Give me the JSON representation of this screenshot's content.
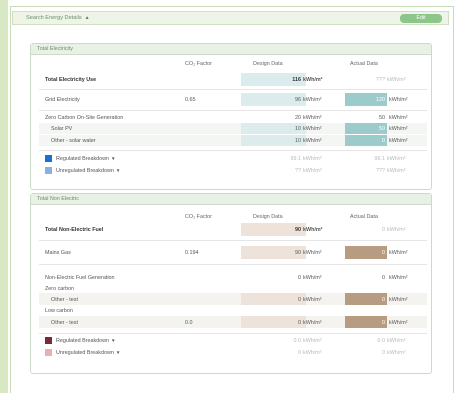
{
  "header": {
    "title": "Search Energy Details",
    "edit_label": "Edit"
  },
  "electricity": {
    "panel_title": "Total Electricity",
    "col_co2": "CO₂ Factor",
    "col_design": "Design Data",
    "col_actual": "Actual Data",
    "rows": {
      "total": {
        "label": "Total Electricity Use",
        "design": "116",
        "design_unit": "kWh/m²",
        "actual": "???",
        "actual_unit": "kWh/m²"
      },
      "grid": {
        "label": "Grid Electricity",
        "co2": "0.65",
        "design": "96",
        "design_unit": "kWh/m²",
        "actual": "120",
        "actual_unit": "kWh/m²"
      },
      "zero_carbon": {
        "label": "Zero Carbon On-Site Generation",
        "design": "20",
        "design_unit": "kWh/m²",
        "actual": "50",
        "actual_unit": "kWh/m²"
      },
      "solar_pv": {
        "label": "Solar PV",
        "design": "10",
        "design_unit": "kWh/m²",
        "actual": "50",
        "actual_unit": "kWh/m²"
      },
      "other_solar": {
        "label": "Other - solar water",
        "design": "10",
        "design_unit": "kWh/m²",
        "actual": "0",
        "actual_unit": "kWh/m²"
      },
      "regulated": {
        "label": "Regulated Breakdown",
        "design": "99.1",
        "design_unit": "kWh/m²",
        "actual": "99.1",
        "actual_unit": "kWh/m²"
      },
      "unregulated": {
        "label": "Unregulated Breakdown",
        "design": "??",
        "design_unit": "kWh/m²",
        "actual": "???",
        "actual_unit": "kWh/m²"
      }
    }
  },
  "non_electric": {
    "panel_title": "Total Non Electric",
    "col_co2": "CO₂ Factor",
    "col_design": "Design Data",
    "col_actual": "Actual Data",
    "rows": {
      "total": {
        "label": "Total Non-Electric Fuel",
        "design": "90",
        "design_unit": "kWh/m²",
        "actual": "0",
        "actual_unit": "kWh/m²"
      },
      "mains_gas": {
        "label": "Mains Gas",
        "co2": "0.194",
        "design": "90",
        "design_unit": "kWh/m²",
        "actual": "0",
        "actual_unit": "kWh/m²"
      },
      "generation": {
        "label": "Non-Electric Fuel Generation",
        "design": "0",
        "design_unit": "kWh/m²",
        "actual": "0",
        "actual_unit": "kWh/m²"
      },
      "zero_carbon_label": "Zero carbon",
      "zero_other": {
        "label": "Other - test",
        "design": "0",
        "design_unit": "kWh/m²",
        "actual": "0",
        "actual_unit": "kWh/m²"
      },
      "low_carbon_label": "Low carbon",
      "low_other": {
        "label": "Other - test",
        "co2": "0.0",
        "design": "0",
        "design_unit": "kWh/m²",
        "actual": "0",
        "actual_unit": "kWh/m²"
      },
      "regulated": {
        "label": "Regulated Breakdown",
        "design": "0.0",
        "design_unit": "kWh/m²",
        "actual": "0.0",
        "actual_unit": "kWh/m²"
      },
      "unregulated": {
        "label": "Unregulated Breakdown",
        "design": "0",
        "design_unit": "kWh/m²",
        "actual": "0",
        "actual_unit": "kWh/m²"
      }
    }
  },
  "colors": {
    "teal_fill": "#9ccbcb",
    "teal_light": "#dcecec",
    "tan_fill": "#b89c82",
    "tan_light": "#ede3da",
    "regulated_elec": "#1a6fd6",
    "unregulated_elec": "#8bb0dd",
    "regulated_fuel": "#7a2a34",
    "unregulated_fuel": "#e8b0b4"
  }
}
